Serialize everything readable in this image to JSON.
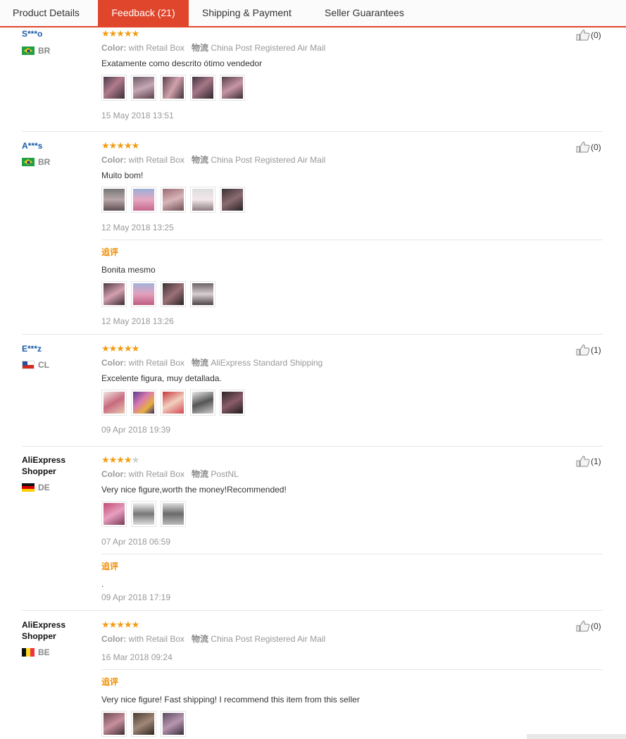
{
  "tabs": [
    {
      "label": "Product Details"
    },
    {
      "label": "Feedback (21)",
      "active": true
    },
    {
      "label": "Shipping & Payment"
    },
    {
      "label": "Seller Guarantees"
    }
  ],
  "accent_color": "#e0462b",
  "star_color": "#f39c11",
  "labels": {
    "color": "Color:",
    "shipping": "物流",
    "followup": "追评"
  },
  "reviews": [
    {
      "user": "S***o",
      "country": "BR",
      "flag": "flag-br",
      "rating": 5,
      "color_value": "with Retail Box",
      "shipping_value": "China Post Registered Air Mail",
      "comment": "Exatamente como descrito ótimo vendedor",
      "photo_count": 5,
      "date": "15 May 2018 13:51",
      "likes": "(0)"
    },
    {
      "user": "A***s",
      "country": "BR",
      "flag": "flag-br",
      "rating": 5,
      "color_value": "with Retail Box",
      "shipping_value": "China Post Registered Air Mail",
      "comment": "Muito bom!",
      "photo_count": 5,
      "date": "12 May 2018 13:25",
      "likes": "(0)",
      "followup": {
        "comment": "Bonita mesmo",
        "photo_count": 4,
        "date": "12 May 2018 13:26"
      }
    },
    {
      "user": "E***z",
      "country": "CL",
      "flag": "flag-cl",
      "rating": 5,
      "color_value": "with Retail Box",
      "shipping_value": "AliExpress Standard Shipping",
      "comment": "Excelente figura, muy detallada.",
      "photo_count": 5,
      "date": "09 Apr 2018 19:39",
      "likes": "(1)"
    },
    {
      "user": "AliExpress Shopper",
      "country": "DE",
      "flag": "flag-de",
      "rating": 4,
      "color_value": "with Retail Box",
      "shipping_value": "PostNL",
      "comment": "Very nice figure,worth the money!Recommended!",
      "photo_count": 3,
      "date": "07 Apr 2018 06:59",
      "likes": "(1)",
      "followup": {
        "comment": ".",
        "date": "09 Apr 2018 17:19"
      }
    },
    {
      "user": "AliExpress Shopper",
      "country": "BE",
      "flag": "flag-be",
      "rating": 5,
      "color_value": "with Retail Box",
      "shipping_value": "China Post Registered Air Mail",
      "date": "16 Mar 2018 09:24",
      "likes": "(0)",
      "followup": {
        "comment": "Very nice figure! Fast shipping! I recommend this item from this seller",
        "photo_count": 3
      }
    }
  ]
}
